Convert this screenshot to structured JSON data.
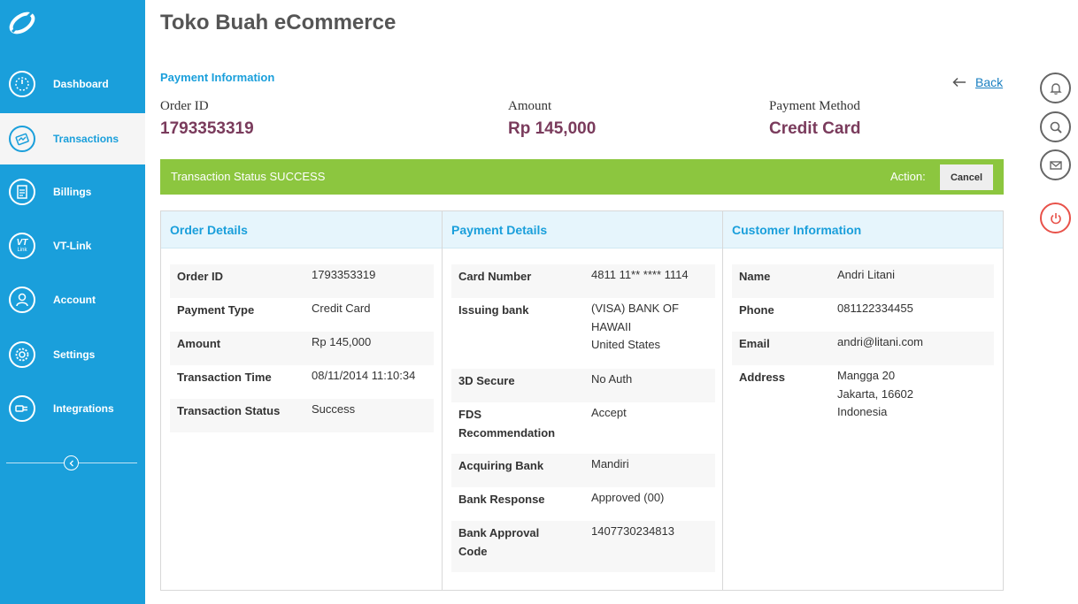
{
  "sidebar": {
    "items": [
      {
        "label": "Dashboard",
        "icon": "dashboard-icon",
        "active": false
      },
      {
        "label": "Transactions",
        "icon": "transactions-icon",
        "active": true
      },
      {
        "label": "Billings",
        "icon": "billings-icon",
        "active": false
      },
      {
        "label": "VT-Link",
        "icon": "vt-link-icon",
        "active": false
      },
      {
        "label": "Account",
        "icon": "account-icon",
        "active": false
      },
      {
        "label": "Settings",
        "icon": "settings-icon",
        "active": false
      },
      {
        "label": "Integrations",
        "icon": "integrations-icon",
        "active": false
      }
    ],
    "vt_icon_text": "VT",
    "vt_icon_subtext": "Link"
  },
  "header": {
    "title": "Toko Buah eCommerce",
    "section": "Payment Information",
    "back_label": "Back"
  },
  "summary": {
    "order_id_label": "Order ID",
    "order_id": "1793353319",
    "amount_label": "Amount",
    "amount": "Rp 145,000",
    "method_label": "Payment Method",
    "method": "Credit Card"
  },
  "status": {
    "text": "Transaction Status SUCCESS",
    "action_label": "Action:",
    "cancel_label": "Cancel"
  },
  "order_details": {
    "title": "Order Details",
    "rows": [
      {
        "key": "Order ID",
        "value": "1793353319"
      },
      {
        "key": "Payment Type",
        "value": "Credit Card"
      },
      {
        "key": "Amount",
        "value": "Rp 145,000"
      },
      {
        "key": "Transaction Time",
        "value": "08/11/2014 11:10:34"
      },
      {
        "key": "Transaction Status",
        "value": "Success"
      }
    ]
  },
  "payment_details": {
    "title": "Payment Details",
    "rows": [
      {
        "key": "Card Number",
        "value": "4811 11** **** 1114"
      },
      {
        "key": "Issuing bank",
        "value": "(VISA) BANK OF\nHAWAII\nUnited States"
      },
      {
        "key": "3D Secure",
        "value": "No Auth"
      },
      {
        "key": "FDS\nRecommendation",
        "value": "Accept"
      },
      {
        "key": "Acquiring Bank",
        "value": "Mandiri"
      },
      {
        "key": "Bank Response",
        "value": "Approved (00)"
      },
      {
        "key": "Bank Approval\nCode",
        "value": "1407730234813"
      }
    ]
  },
  "customer_info": {
    "title": "Customer Information",
    "rows": [
      {
        "key": "Name",
        "value": "Andri Litani"
      },
      {
        "key": "Phone",
        "value": "081122334455"
      },
      {
        "key": "Email",
        "value": "andri@litani.com"
      },
      {
        "key": "Address",
        "value": "Mangga 20\nJakarta, 16602\nIndonesia"
      }
    ]
  },
  "right_icons": [
    "bell-icon",
    "search-icon",
    "mail-icon",
    "power-icon"
  ],
  "colors": {
    "sidebar": "#1a9fdb",
    "accent": "#1a9fdb",
    "status_success": "#8cc63f",
    "summary_value": "#7a3b5c",
    "power": "#e8524a"
  }
}
